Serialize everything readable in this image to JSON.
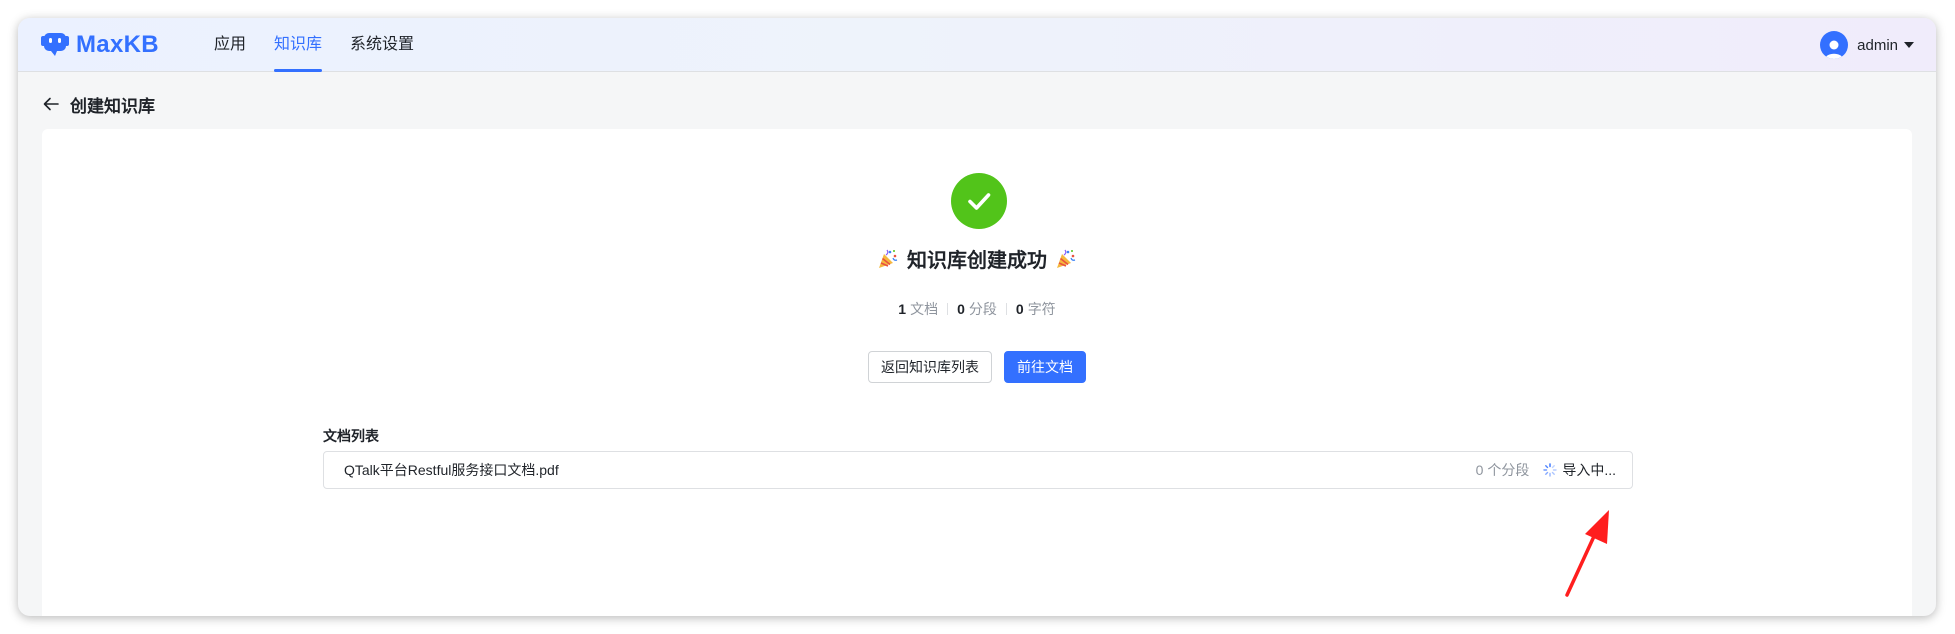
{
  "app": {
    "name": "MaxKB",
    "accent_color": "#3370ff"
  },
  "nav": {
    "items": [
      {
        "label": "应用",
        "active": false
      },
      {
        "label": "知识库",
        "active": true
      },
      {
        "label": "系统设置",
        "active": false
      }
    ]
  },
  "user": {
    "name": "admin",
    "avatar_icon": "user-avatar-icon"
  },
  "page": {
    "title": "创建知识库",
    "back_icon": "arrow-left-icon"
  },
  "result": {
    "status_icon": "check-circle-icon",
    "status_color": "#52c41a",
    "title": "知识库创建成功",
    "decoration_icon": "party-popper-icon",
    "stats": [
      {
        "value": "1",
        "label": "文档"
      },
      {
        "value": "0",
        "label": "分段"
      },
      {
        "value": "0",
        "label": "字符"
      }
    ]
  },
  "actions": {
    "back_label": "返回知识库列表",
    "goto_label": "前往文档"
  },
  "doc_list": {
    "label": "文档列表",
    "items": [
      {
        "name": "QTalk平台Restful服务接口文档.pdf",
        "segments": "0 个分段",
        "status": "导入中...",
        "status_icon": "loading-icon"
      }
    ]
  },
  "annotation": {
    "arrow_color": "#ff1e1e"
  }
}
